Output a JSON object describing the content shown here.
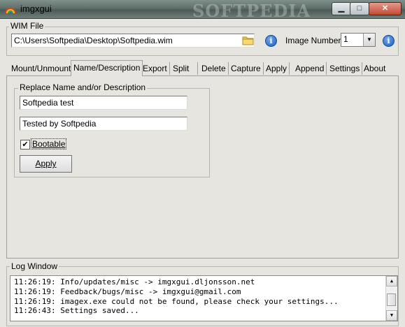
{
  "window": {
    "title": "imgxgui",
    "watermark": "SOFTPEDIA"
  },
  "wim": {
    "group_label": "WIM File",
    "path": "C:\\Users\\Softpedia\\Desktop\\Softpedia.wim",
    "image_number_label": "Image Number:",
    "image_number": "1"
  },
  "tabs": [
    "Mount/Unmount",
    "Name/Description",
    "Export",
    "Split",
    "Delete",
    "Capture",
    "Apply",
    "Append",
    "Settings",
    "About"
  ],
  "active_tab": "Name/Description",
  "panel": {
    "group_label": "Replace Name and/or Description",
    "name_value": "Softpedia test",
    "description_value": "Tested by Softpedia",
    "bootable_label": "Bootable",
    "bootable_checked": true,
    "apply_label": "Apply"
  },
  "log": {
    "label": "Log Window",
    "lines": [
      "11:26:19: Info/updates/misc -> imgxgui.dljonsson.net",
      "11:26:19: Feedback/bugs/misc -> imgxgui@gmail.com",
      "11:26:19: imagex.exe could not be found, please check your settings...",
      "11:26:43: Settings saved..."
    ]
  },
  "colors": {
    "window_bg": "#e7e5df",
    "titlebar": "#5f6f6a",
    "info_icon": "#1f5fb8"
  },
  "icons": [
    "app-rainbow-icon",
    "folder-icon",
    "info-icon",
    "minimize-icon",
    "maximize-icon",
    "close-icon"
  ]
}
